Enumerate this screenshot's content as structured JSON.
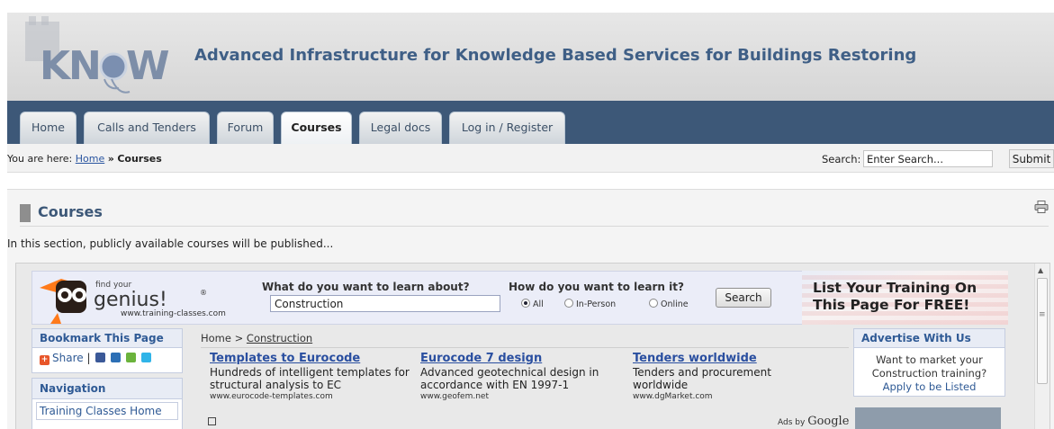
{
  "header": {
    "logo_text": "KNOW",
    "site_title": "Advanced Infrastructure for Knowledge Based Services for Buildings Restoring"
  },
  "nav": {
    "tabs": [
      {
        "label": "Home"
      },
      {
        "label": "Calls and Tenders"
      },
      {
        "label": "Forum"
      },
      {
        "label": "Courses"
      },
      {
        "label": "Legal docs"
      },
      {
        "label": "Log in / Register"
      }
    ],
    "active": "Courses"
  },
  "breadcrumb": {
    "prefix": "You are here:",
    "home": "Home",
    "separator": "»",
    "current": "Courses"
  },
  "search": {
    "label": "Search:",
    "value": "Enter Search...",
    "submit": "Submit"
  },
  "main": {
    "title": "Courses",
    "intro": "In this section, publicly available courses will be published..."
  },
  "embed": {
    "brand_top": "find your",
    "brand": "genius!",
    "brand_mark": "®",
    "brand_url": "www.training-classes.com",
    "question_what": "What do you want to learn about?",
    "query_value": "Construction",
    "question_how": "How do you want to learn it?",
    "modes": [
      {
        "label": "All",
        "selected": true
      },
      {
        "label": "In-Person",
        "selected": false
      },
      {
        "label": "Online",
        "selected": false
      }
    ],
    "search_button": "Search",
    "promo": "List Your Training On This Page For FREE!",
    "bookmark_heading": "Bookmark This Page",
    "share_label": "Share",
    "share_separator": "|",
    "navigation_heading": "Navigation",
    "nav_links": [
      "Training Classes Home"
    ],
    "breadcrumb_home": "Home",
    "breadcrumb_separator": ">",
    "breadcrumb_current": "Construction",
    "ads": [
      {
        "title": "Templates to Eurocode",
        "desc": "Hundreds of intelligent templates for structural analysis to EC",
        "url": "www.eurocode-templates.com"
      },
      {
        "title": "Eurocode 7 design",
        "desc": "Advanced geotechnical design in accordance with EN 1997-1",
        "url": "www.geofem.net"
      },
      {
        "title": "Tenders worldwide",
        "desc": "Tenders and procurement worldwide",
        "url": "www.dgMarket.com"
      }
    ],
    "ads_by": "Ads by",
    "ads_by_brand": "Google",
    "advertise_heading": "Advertise With Us",
    "advertise_line1": "Want to market your",
    "advertise_line2": "Construction training?",
    "advertise_link": "Apply to be Listed"
  },
  "colors": {
    "nav_bg": "#3d5878",
    "title_blue": "#3f5f86",
    "link_blue": "#2a4fa0"
  }
}
